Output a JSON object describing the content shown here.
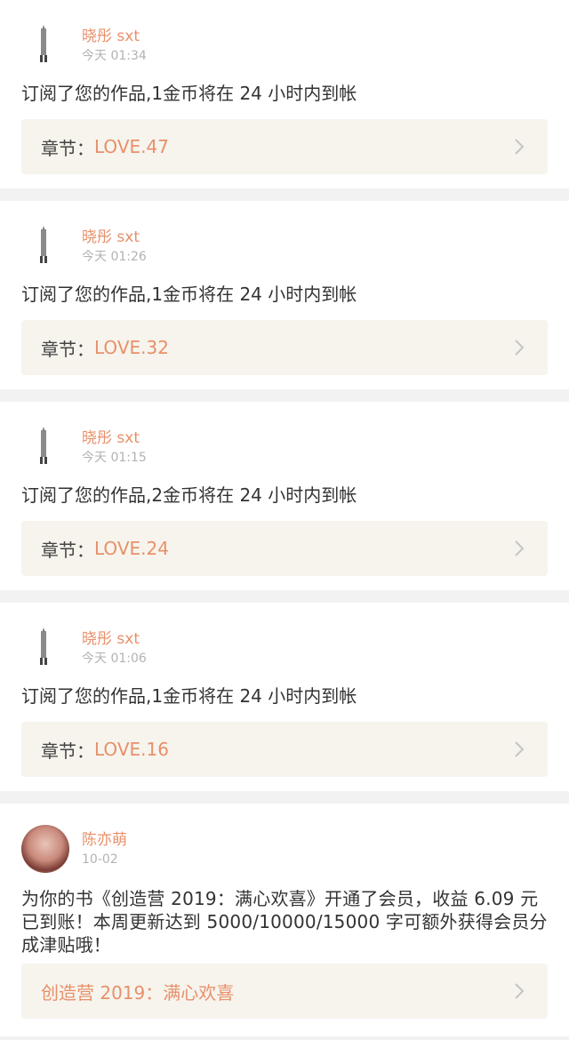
{
  "notifications": [
    {
      "type": "subscribe",
      "username": "晓彤 sxt",
      "time": "今天 01:34",
      "message": "订阅了您的作品,1金币将在 24 小时内到帐",
      "link_prefix": "章节：",
      "link_value": "LOVE.47"
    },
    {
      "type": "subscribe",
      "username": "晓彤 sxt",
      "time": "今天 01:26",
      "message": "订阅了您的作品,1金币将在 24 小时内到帐",
      "link_prefix": "章节：",
      "link_value": "LOVE.32"
    },
    {
      "type": "subscribe",
      "username": "晓彤 sxt",
      "time": "今天 01:15",
      "message": "订阅了您的作品,2金币将在 24 小时内到帐",
      "link_prefix": "章节：",
      "link_value": "LOVE.24"
    },
    {
      "type": "subscribe",
      "username": "晓彤 sxt",
      "time": "今天 01:06",
      "message": "订阅了您的作品,1金币将在 24 小时内到帐",
      "link_prefix": "章节：",
      "link_value": "LOVE.16"
    },
    {
      "type": "member",
      "username": "陈亦萌",
      "time": "10-02",
      "message": "为你的书《创造营 2019：满心欢喜》开通了会员，收益 6.09 元已到账！本周更新达到 5000/10000/15000 字可额外获得会员分成津贴哦！",
      "link_value": "创造营 2019：满心欢喜"
    }
  ],
  "colors": {
    "accent": "#e8906a",
    "text": "#333333",
    "muted": "#b3b3b3",
    "link_bg": "#f6f4ed",
    "divider": "#f2f2f2"
  },
  "icons": {
    "avatar_stick": "stick-figure-avatar-icon",
    "avatar_round": "user-photo-avatar",
    "chevron": "chevron-right-icon"
  }
}
